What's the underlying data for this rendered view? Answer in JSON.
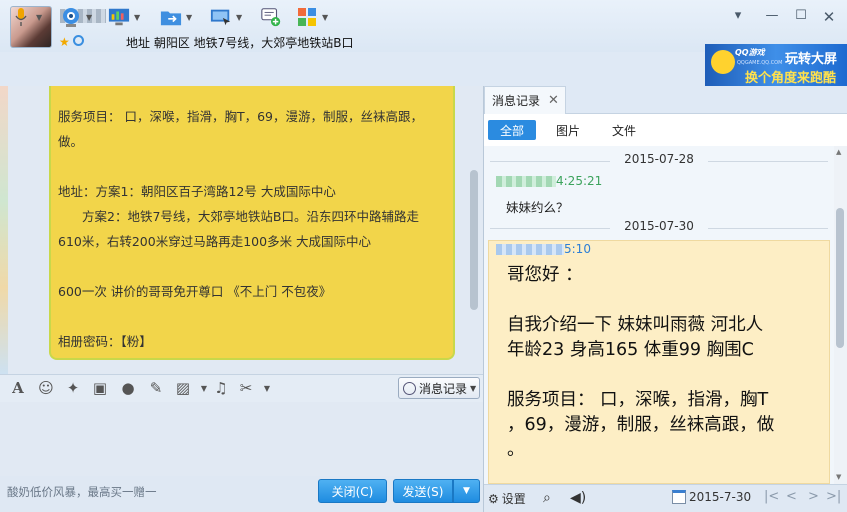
{
  "title_bar": {
    "signature": "地址 朝阳区 地铁7号线，大郊亭地铁站B口",
    "controls": {
      "menu": "▾",
      "minimize": "—",
      "maximize": "☐",
      "close": "✕"
    }
  },
  "ad_banner": {
    "brand": "QQ游戏",
    "brand_sub": "QQGAME.QQ.COM",
    "line1": "玩转大屏",
    "line2": "换个角度来跑酷"
  },
  "chat_bubble": {
    "lines": [
      "服务项目： 口，深喉，指滑，胸T，69，漫游，制服，丝袜高跟，",
      "做。",
      "",
      "地址：方案1：朝阳区百子湾路12号 大成国际中心",
      "方案2：地铁7号线，大郊亭地铁站B口。沿东四环中路辅路走",
      "610米，右转200米穿过马路再走100多米 大成国际中心",
      "",
      "600一次 讲价的哥哥免开尊口 《不上门 不包夜》",
      "",
      "相册密码：【粉】"
    ]
  },
  "input_toolbar": {
    "history_button": "消息记录"
  },
  "bottom_bar": {
    "ad_text": "酸奶低价风暴，最高买一赠一",
    "close_button": "关闭(C)",
    "send_button": "发送(S)"
  },
  "history_panel": {
    "tab_label": "消息记录",
    "filters": [
      "全部",
      "图片",
      "文件"
    ],
    "active_filter": "全部",
    "date1": "2015-07-28",
    "msg1_time": "4:25:21",
    "msg1_text": "妹妹约么？",
    "date2": "2015-07-30",
    "msg2_time": "5:10",
    "msg2_lines": [
      "哥您好 ：",
      "",
      "自我介绍一下 妹妹叫雨薇 河北人",
      "年龄23 身高165 体重99 胸围C",
      "",
      "服务项目： 口，深喉，指滑，胸T",
      "，69，漫游，制服，丝袜高跟，做",
      "。"
    ],
    "settings_label": "设置",
    "current_date": "2015-7-30"
  },
  "colors": {
    "accent": "#2b8be0",
    "bubble": "#f2d54a",
    "history_highlight": "#fdeec5",
    "sender_green": "#3da35d"
  }
}
